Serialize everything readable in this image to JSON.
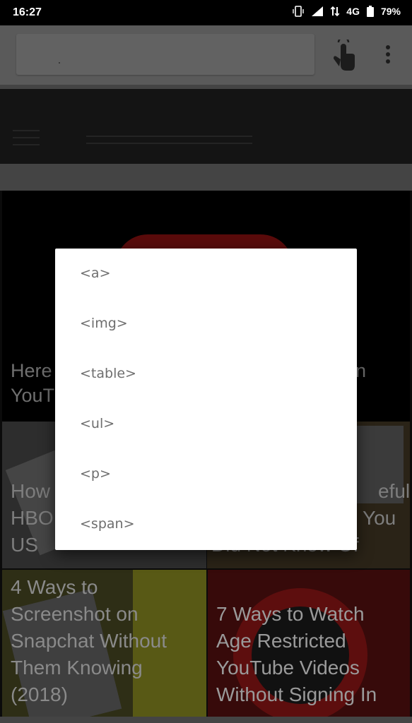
{
  "status_bar": {
    "time": "16:27",
    "network": "4G",
    "battery": "79%"
  },
  "page": {
    "hero_title_line1": "Here",
    "hero_title_right": "n",
    "hero_title_line2": "YouT",
    "cards": [
      {
        "lines": [
          "How",
          "HBO",
          "US"
        ]
      },
      {
        "lines": [
          "eful",
          "You",
          "Did Not Know Of"
        ]
      },
      {
        "lines": [
          "4 Ways to",
          "Screenshot on",
          "Snapchat Without",
          "Them Knowing",
          "(2018)"
        ]
      },
      {
        "lines": [
          "7 Ways to Watch",
          "Age Restricted",
          "YouTube Videos",
          "Without Signing In"
        ]
      }
    ]
  },
  "dialog": {
    "items": [
      "<a>",
      "<img>",
      "<table>",
      "<ul>",
      "<p>",
      "<span>"
    ]
  }
}
